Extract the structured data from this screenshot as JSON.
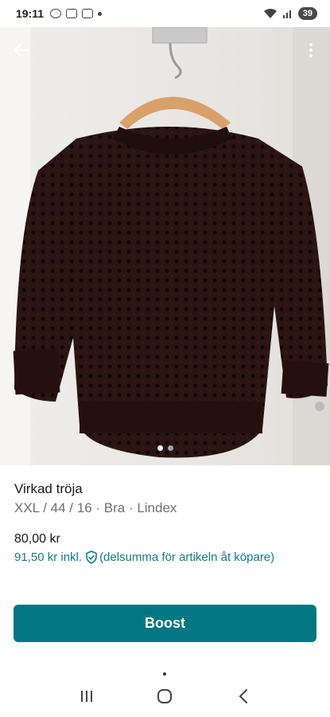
{
  "status_bar": {
    "time": "19:11",
    "battery": "39"
  },
  "top_actions": {
    "back_icon": "arrow-left-icon",
    "more_icon": "more-vertical-icon"
  },
  "gallery": {
    "image": "brown crocheted sweater on wooden hanger",
    "slide_count": 2,
    "active_slide": 1
  },
  "item": {
    "title": "Virkad tröja",
    "details": "XXL / 44 / 16 · Bra · Lindex",
    "price": "80,00 kr",
    "price_incl_amount": "91,50 kr",
    "price_incl_label": "inkl.",
    "price_incl_note": "(delsumma för artikeln åt köpare)"
  },
  "actions": {
    "boost_label": "Boost"
  },
  "colors": {
    "accent": "#007782",
    "link": "#127b86",
    "sweater": "#2b1513"
  }
}
